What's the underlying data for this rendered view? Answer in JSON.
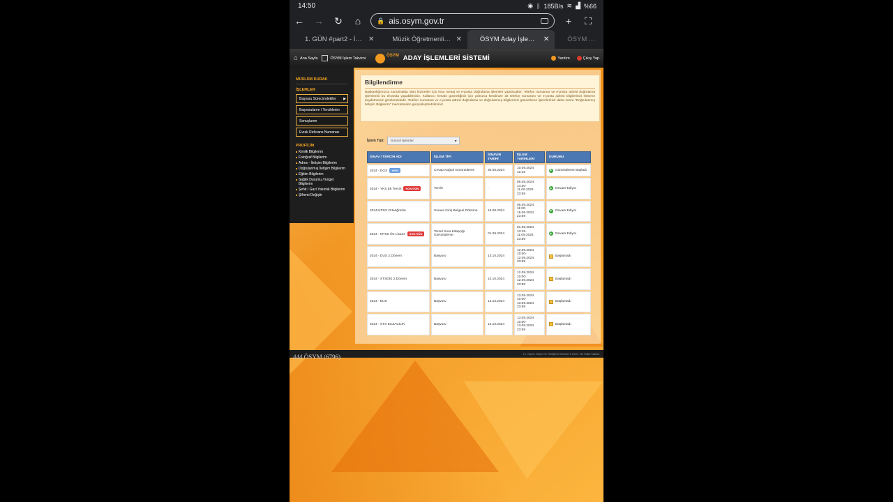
{
  "status": {
    "time": "14:50",
    "speed": "185B/s",
    "battery": "%66"
  },
  "browser": {
    "url": "ais.osym.gov.tr",
    "tabs": [
      {
        "label": "1. GÜN #part2 - İn..."
      },
      {
        "label": "Müzik Öğretmenliğ..."
      },
      {
        "label": "ÖSYM Aday İşlemle..."
      },
      {
        "label": "ÖSYM Sonu"
      }
    ]
  },
  "header": {
    "home": "Ana Sayfa",
    "calendar": "ÖSYM İşlem Takvimi",
    "logo_word": "ÖSYM",
    "title": "ADAY İŞLEMLERİ SİSTEMİ",
    "help": "Yardım",
    "logout": "Çıkış Yap"
  },
  "sidebar": {
    "user": "MÜSLÜM DURAK",
    "islemler_heading": "İŞLEMLER",
    "buttons": [
      "Başvuru Süreciındekiler",
      "Başvurularım / Tercihlerim",
      "Sonuçlarım",
      "Evrak Referans Numarası"
    ],
    "profil_heading": "PROFİLİM",
    "links": [
      "Kimlik Bilgilerim",
      "Fotoğraf Bilgilerim",
      "Adres - İletişim Bilgilerim",
      "Doğrulanmış İletişim Bilgilerim",
      "Eğitim Bilgilerim",
      "Sağlık Durumu / Engel Bilgilerim",
      "Şehit / Gazi Yakınlık Bilgilerim",
      "Şifremi Değiştir"
    ]
  },
  "info": {
    "title": "Bilgilendirme",
    "text": "Başkanlığımızca sunulmakta olan hizmetler için kısa mesaj ve e-posta doğrulama işlemleri yapılacaktır. Telefon numarası ve e-posta adresi doğrulama işlemlerini bu ekranda yapabilirsiniz. Kullanıcı hesabı güvenliğiniz için yalnızca kendinize ait telefon numarası ve e-posta adresi bilgilerinizi sisteme kaydetmeniz gerekmektedir. Telefon numarası ve e-posta adresi doğrulama ve doğrulanmış bilgilerinizi güncelleme işlemlerinizi daha sonra \"Doğrulanmış İletişim Bilgilerim\" menüsünden gerçekleştirebilirsiniz."
  },
  "filter": {
    "label": "İşlem Tipi:",
    "value": "Güncel İşlemler"
  },
  "table": {
    "headers": [
      "SINAV / TERCİH ADI",
      "İŞLEM TİPİ",
      "SINAVIN TARİHİ",
      "İŞLEM TARİHLERİ",
      "DURUMU"
    ],
    "rows": [
      {
        "name": "2024 - DGS",
        "badge": "YENİ",
        "badge_type": "new",
        "type": "Cevap Kağıdı Görüntüleme",
        "date": "30.06.2024",
        "times": "10.09.2024 10:15",
        "status": "Görüntüleme Başladı",
        "state": "active"
      },
      {
        "name": "2024 - YKS Ek Tercih",
        "badge": "SON GÜN",
        "badge_type": "last",
        "type": "Tercih",
        "date": "-",
        "times": "06.09.2024 14:30- 11.09.2024 23:59",
        "status": "Devam Ediyor",
        "state": "active"
      },
      {
        "name": "2024-KPSS Ortaöğretim",
        "badge": "",
        "badge_type": "",
        "type": "Sınava Giriş Belgesi Dökümü",
        "date": "15.09.2024",
        "times": "05.09.2024 11:00- 15.09.2024 23:59",
        "status": "Devam Ediyor",
        "state": "active"
      },
      {
        "name": "2024 - KPSS Ön Lisans",
        "badge": "SON GÜN",
        "badge_type": "last",
        "type": "Temel Soru Kitapçığı Görüntüleme",
        "date": "01.09.2024",
        "times": "01.09.2024 13:15- 11.09.2024 23:59",
        "status": "Devam Ediyor",
        "state": "active"
      },
      {
        "name": "2024 - DUS 2.Dönem",
        "badge": "",
        "badge_type": "",
        "type": "Başvuru",
        "date": "13.10.2024",
        "times": "12.09.2024 10:00- 12.09.2024 23:59",
        "status": "Başlamadı",
        "state": "waiting"
      },
      {
        "name": "2024 - STSDİS 2.Dönem",
        "badge": "",
        "badge_type": "",
        "type": "Başvuru",
        "date": "13.10.2024",
        "times": "12.09.2024 10:00- 12.09.2024 23:59",
        "status": "Başlamadı",
        "state": "waiting"
      },
      {
        "name": "2024 - EUS",
        "badge": "",
        "badge_type": "",
        "type": "Başvuru",
        "date": "13.10.2024",
        "times": "13.09.2024 10:00- 13.09.2024 23:59",
        "status": "Başlamadı",
        "state": "waiting"
      },
      {
        "name": "2024 - STS ECZACILIK",
        "badge": "",
        "badge_type": "",
        "type": "Başvuru",
        "date": "13.10.2024",
        "times": "13.09.2024 10:00- 13.09.2024 23:59",
        "status": "Başlamadı",
        "state": "waiting"
      }
    ]
  },
  "footer": {
    "phone": "444 ÖSYM (6796)",
    "copyright": "T.C. Ölçme, Seçme ve Yerleştirme Merkezi © 2013 - Her Hakkı Saklıdır."
  },
  "colors": {
    "brand_orange": "#f29a1f",
    "header_blue": "#4b77b3",
    "sidebar_bg": "#1e1e1e"
  }
}
